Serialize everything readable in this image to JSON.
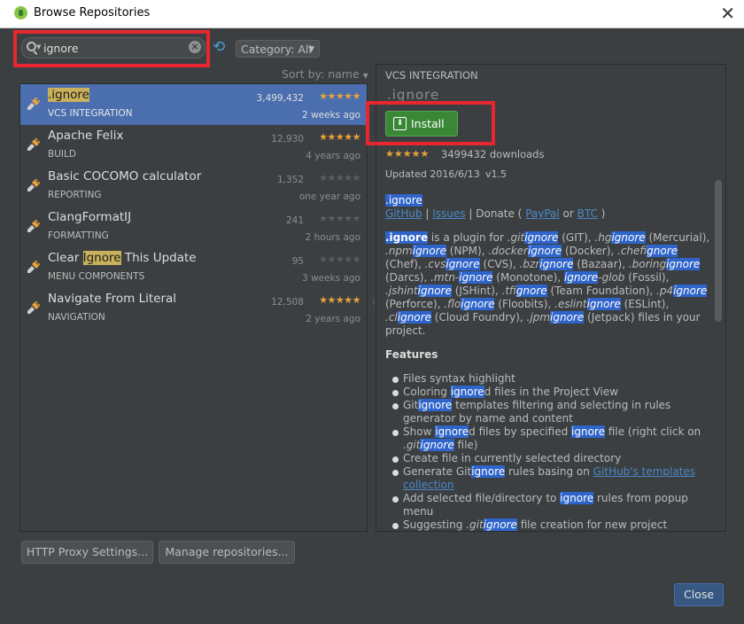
{
  "window": {
    "title": "Browse Repositories"
  },
  "search": {
    "value": "ignore"
  },
  "category": {
    "label": "Category: All"
  },
  "sort": {
    "label": "Sort by: name"
  },
  "plugins": [
    {
      "name_pre": "",
      "name_hl": ".ignore",
      "name_post": "",
      "category": "VCS INTEGRATION",
      "downloads": "3,499,432",
      "age": "2 weeks ago",
      "rating": 4.5
    },
    {
      "name_pre": "Apache Felix",
      "name_hl": "",
      "name_post": "",
      "category": "BUILD",
      "downloads": "12,930",
      "age": "4 years ago",
      "rating": 4.5
    },
    {
      "name_pre": "Basic COCOMO calculator",
      "name_hl": "",
      "name_post": "",
      "category": "REPORTING",
      "downloads": "1,352",
      "age": "one year ago",
      "rating": 0
    },
    {
      "name_pre": "ClangFormatIJ",
      "name_hl": "",
      "name_post": "",
      "category": "FORMATTING",
      "downloads": "241",
      "age": "2 hours ago",
      "rating": 0
    },
    {
      "name_pre": "Clear ",
      "name_hl": "Ignore",
      "name_post": " This Update",
      "category": "MENU COMPONENTS",
      "downloads": "95",
      "age": "3 weeks ago",
      "rating": 0
    },
    {
      "name_pre": "Navigate From Literal",
      "name_hl": "",
      "name_post": "",
      "category": "NAVIGATION",
      "downloads": "12,508",
      "age": "2 years ago",
      "rating": 5
    }
  ],
  "detail": {
    "category": "VCS INTEGRATION",
    "name": ".ignore",
    "install_label": "Install",
    "rating": 4.5,
    "downloads": "3499432 downloads",
    "updated": "Updated 2016/6/13",
    "version": "v1.5",
    "features_title": "Features"
  },
  "buttons": {
    "proxy": "HTTP Proxy Settings...",
    "manage": "Manage repositories...",
    "close": "Close"
  },
  "colors": {
    "selection": "#4b6eaf",
    "install": "#3a8735",
    "highlight_box": "#e8262f",
    "star": "#e9a23b"
  }
}
